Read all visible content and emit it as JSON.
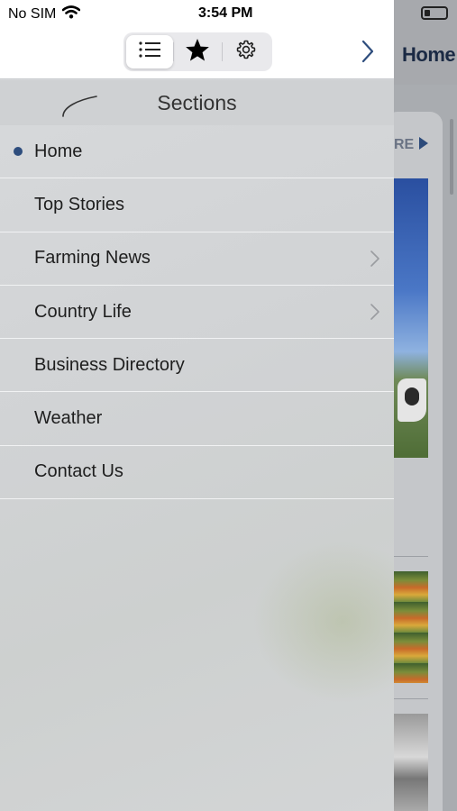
{
  "status_bar": {
    "carrier": "No SIM",
    "time": "3:54 PM"
  },
  "toolbar": {
    "segments": [
      {
        "icon": "list-icon",
        "selected": true
      },
      {
        "icon": "star-icon",
        "selected": false
      },
      {
        "icon": "gear-icon",
        "selected": false
      }
    ],
    "forward_icon": "chevron-right-icon"
  },
  "sections": {
    "title": "Sections",
    "back_icon": "swoosh-back-icon",
    "items": [
      {
        "label": "Home",
        "current": true,
        "has_submenu": false
      },
      {
        "label": "Top Stories",
        "current": false,
        "has_submenu": false
      },
      {
        "label": "Farming News",
        "current": false,
        "has_submenu": true
      },
      {
        "label": "Country Life",
        "current": false,
        "has_submenu": true
      },
      {
        "label": "Business Directory",
        "current": false,
        "has_submenu": false
      },
      {
        "label": "Weather",
        "current": false,
        "has_submenu": false
      },
      {
        "label": "Contact Us",
        "current": false,
        "has_submenu": false
      }
    ]
  },
  "background_app": {
    "title": "Home",
    "more_link_partial": "RE"
  },
  "colors": {
    "accent": "#2e4d7d",
    "panel_bg": "#d3d5d6",
    "toolbar_bg": "#ffffff"
  }
}
